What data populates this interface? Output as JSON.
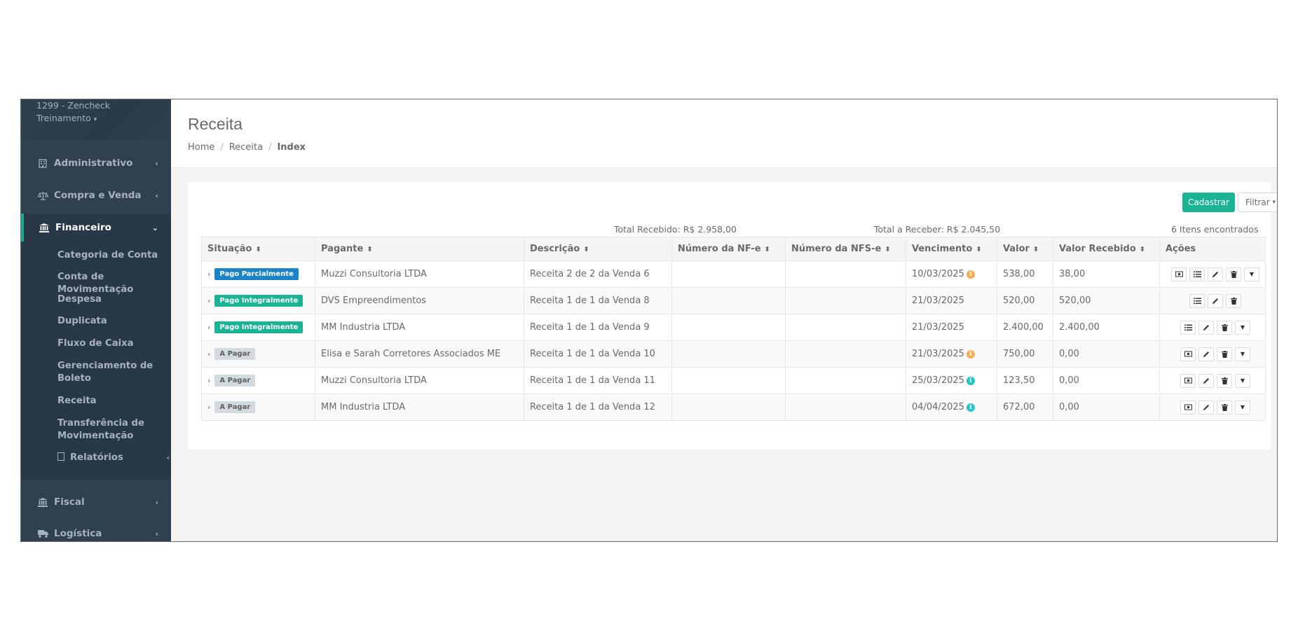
{
  "sidebar": {
    "account_line1": "1299 - Zencheck",
    "account_line2": "Treinamento",
    "items": [
      {
        "label": "Administrativo",
        "icon": "building-icon"
      },
      {
        "label": "Compra e Venda",
        "icon": "scale-icon"
      },
      {
        "label": "Financeiro",
        "icon": "bank-icon"
      },
      {
        "label": "Fiscal",
        "icon": "bank-icon"
      },
      {
        "label": "Logística",
        "icon": "truck-icon"
      }
    ],
    "sub_items": [
      {
        "label": "Categoria de Conta"
      },
      {
        "label": "Conta de Movimentação"
      },
      {
        "label": "Despesa"
      },
      {
        "label": "Duplicata"
      },
      {
        "label": "Fluxo de Caixa"
      },
      {
        "label": "Gerenciamento de Boleto"
      },
      {
        "label": "Receita"
      },
      {
        "label": "Transferência de Movimentação"
      },
      {
        "label": "Relatórios",
        "icon": "file-icon"
      }
    ]
  },
  "page": {
    "title": "Receita",
    "breadcrumb": [
      "Home",
      "Receita",
      "Index"
    ]
  },
  "toolbar": {
    "cadastrar_label": "Cadastrar",
    "filtrar_label": "Filtrar"
  },
  "summary": {
    "total_recebido": "Total Recebido: R$ 2.958,00",
    "total_a_receber": "Total a Receber: R$ 2.045,50",
    "count": "6 Itens encontrados"
  },
  "table": {
    "columns": [
      "Situação",
      "Pagante",
      "Descrição",
      "Número da NF-e",
      "Número da NFS-e",
      "Vencimento",
      "Valor",
      "Valor Recebido",
      "Ações"
    ],
    "rows": [
      {
        "situacao": "Pago Parcialmente",
        "status": "blue",
        "pagante": "Muzzi Consultoria LTDA",
        "descricao": "Receita 2 de 2 da Venda 6",
        "nfe": "",
        "nfse": "",
        "vencimento": "10/03/2025",
        "info": "orange",
        "valor": "538,00",
        "recebido": "38,00",
        "actions": [
          "money-icon",
          "list-icon",
          "pencil-icon",
          "trash-icon",
          "caret-down-icon"
        ]
      },
      {
        "situacao": "Pago Integralmente",
        "status": "green",
        "pagante": "DVS Empreendimentos",
        "descricao": "Receita 1 de 1 da Venda 8",
        "nfe": "",
        "nfse": "",
        "vencimento": "21/03/2025",
        "info": "",
        "valor": "520,00",
        "recebido": "520,00",
        "actions": [
          "list-icon",
          "pencil-icon",
          "trash-icon"
        ]
      },
      {
        "situacao": "Pago Integralmente",
        "status": "green",
        "pagante": "MM Industria LTDA",
        "descricao": "Receita 1 de 1 da Venda 9",
        "nfe": "",
        "nfse": "",
        "vencimento": "21/03/2025",
        "info": "",
        "valor": "2.400,00",
        "recebido": "2.400,00",
        "actions": [
          "list-icon",
          "pencil-icon",
          "trash-icon",
          "caret-down-icon"
        ]
      },
      {
        "situacao": "A Pagar",
        "status": "gray",
        "pagante": "Elisa e Sarah Corretores Associados ME",
        "descricao": "Receita 1 de 1 da Venda 10",
        "nfe": "",
        "nfse": "",
        "vencimento": "21/03/2025",
        "info": "orange",
        "valor": "750,00",
        "recebido": "0,00",
        "actions": [
          "money-icon",
          "pencil-icon",
          "trash-icon",
          "caret-down-icon"
        ]
      },
      {
        "situacao": "A Pagar",
        "status": "gray",
        "pagante": "Muzzi Consultoria LTDA",
        "descricao": "Receita 1 de 1 da Venda 11",
        "nfe": "",
        "nfse": "",
        "vencimento": "25/03/2025",
        "info": "teal",
        "valor": "123,50",
        "recebido": "0,00",
        "actions": [
          "money-icon",
          "pencil-icon",
          "trash-icon",
          "caret-down-icon"
        ]
      },
      {
        "situacao": "A Pagar",
        "status": "gray",
        "pagante": "MM Industria LTDA",
        "descricao": "Receita 1 de 1 da Venda 12",
        "nfe": "",
        "nfse": "",
        "vencimento": "04/04/2025",
        "info": "teal",
        "valor": "672,00",
        "recebido": "0,00",
        "actions": [
          "money-icon",
          "pencil-icon",
          "trash-icon",
          "caret-down-icon"
        ]
      }
    ]
  },
  "colors": {
    "sidebar_bg": "#2f4050",
    "accent": "#1ab394",
    "status_blue": "#1c84c6",
    "status_green": "#1ab394",
    "status_gray": "#d1dade",
    "info_orange": "#f8ac59",
    "info_teal": "#23c6c8"
  }
}
